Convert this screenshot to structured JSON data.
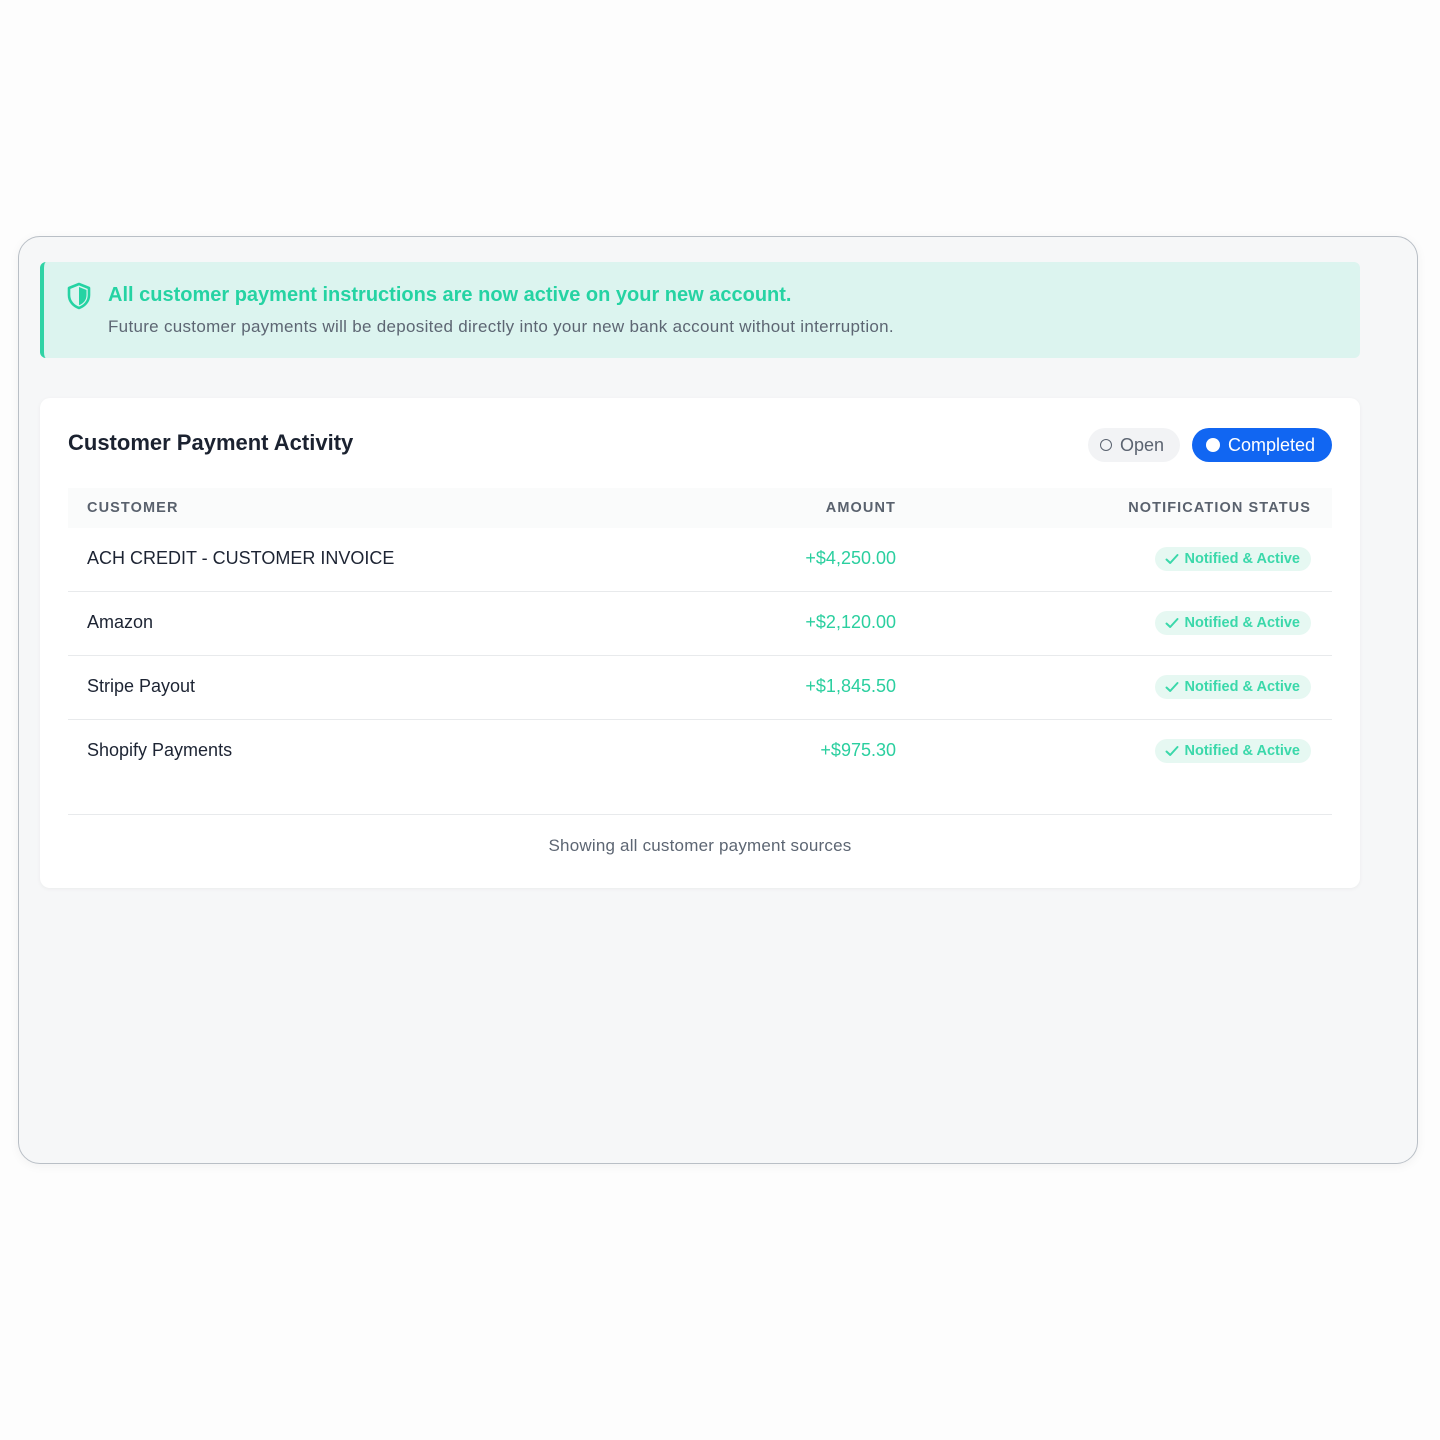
{
  "banner": {
    "icon": "shield-icon",
    "title": "All customer payment instructions are now active on your new account.",
    "subtitle": "Future customer payments will be deposited directly into your new bank account without interruption."
  },
  "activity": {
    "title": "Customer Payment Activity",
    "filters": {
      "open_label": "Open",
      "completed_label": "Completed",
      "selected": "Completed"
    },
    "columns": {
      "customer": "CUSTOMER",
      "amount": "AMOUNT",
      "status": "NOTIFICATION STATUS"
    },
    "rows": [
      {
        "customer": "ACH CREDIT - CUSTOMER INVOICE",
        "amount": "+$4,250.00",
        "status": "Notified & Active"
      },
      {
        "customer": "Amazon",
        "amount": "+$2,120.00",
        "status": "Notified & Active"
      },
      {
        "customer": "Stripe Payout",
        "amount": "+$1,845.50",
        "status": "Notified & Active"
      },
      {
        "customer": "Shopify Payments",
        "amount": "+$975.30",
        "status": "Notified & Active"
      }
    ],
    "footer": "Showing all customer payment sources"
  },
  "colors": {
    "accent_green": "#2bcf9f",
    "banner_bg": "#dcf4ef",
    "primary_blue": "#1166f2"
  }
}
